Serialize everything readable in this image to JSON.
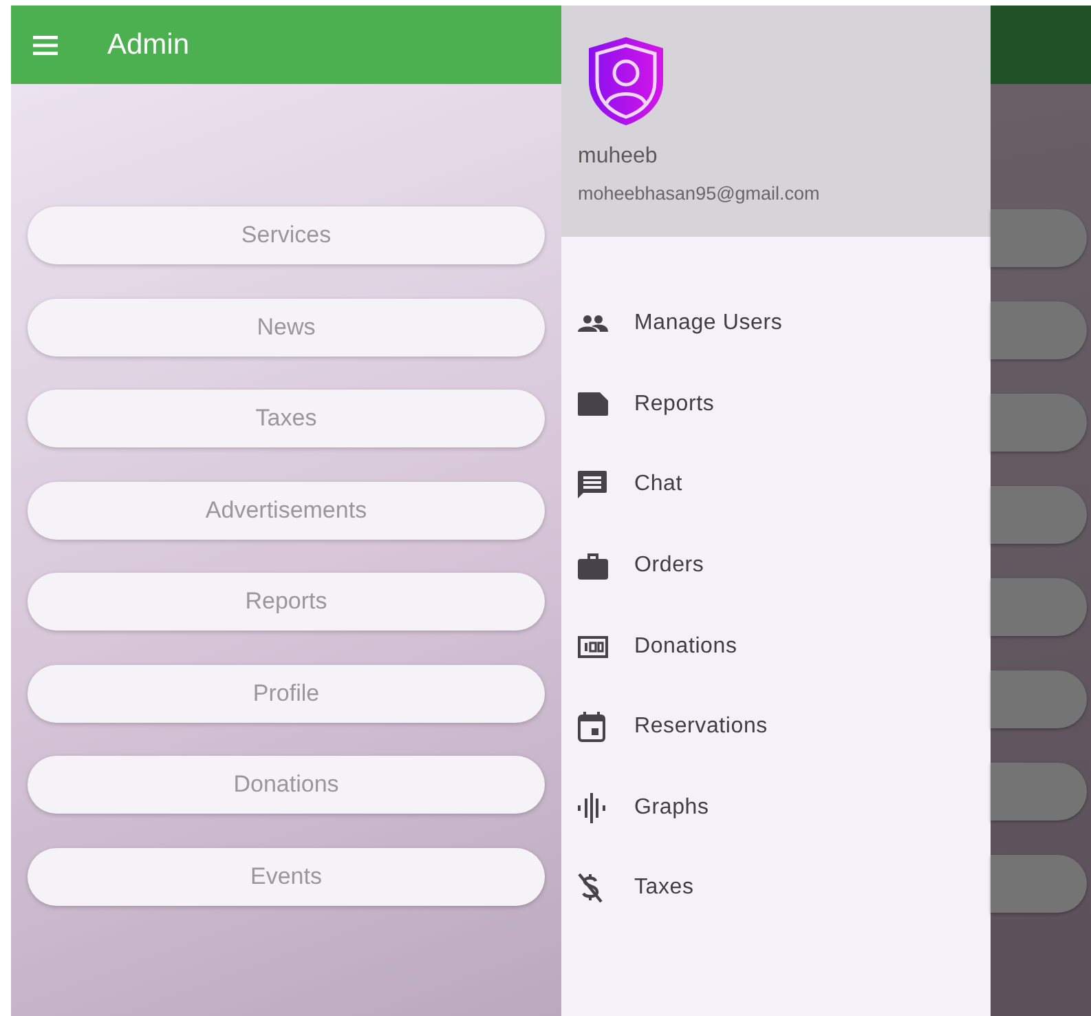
{
  "app_bar": {
    "title": "Admin"
  },
  "menu_buttons": [
    "Services",
    "News",
    "Taxes",
    "Advertisements",
    "Reports",
    "Profile",
    "Donations",
    "Events"
  ],
  "drawer": {
    "user_name": "muheeb",
    "email": "moheebhasan95@gmail.com",
    "items": [
      {
        "label": "Manage Users"
      },
      {
        "label": "Reports"
      },
      {
        "label": "Chat"
      },
      {
        "label": "Orders"
      },
      {
        "label": "Donations"
      },
      {
        "label": "Reservations"
      },
      {
        "label": "Graphs"
      },
      {
        "label": "Taxes"
      }
    ]
  }
}
